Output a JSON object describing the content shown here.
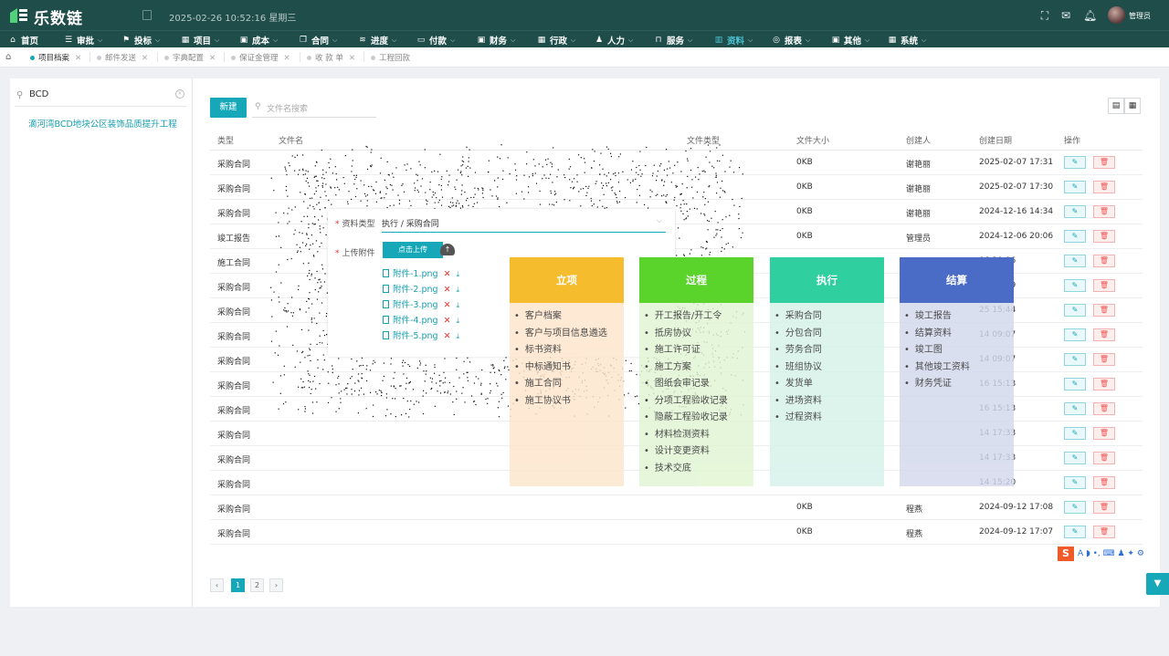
{
  "header": {
    "app_name": "乐数链",
    "datetime": "2025-02-26 10:52:16 星期三",
    "user_name": "管理员",
    "icons": [
      "fullscreen-icon",
      "mail-icon",
      "bell-icon"
    ]
  },
  "nav": [
    {
      "label": "首页",
      "icon": "home-icon",
      "chevron": false
    },
    {
      "label": "审批",
      "icon": "sliders-icon",
      "chevron": true
    },
    {
      "label": "投标",
      "icon": "flag-icon",
      "chevron": true
    },
    {
      "label": "项目",
      "icon": "grid-icon",
      "chevron": true
    },
    {
      "label": "成本",
      "icon": "calendar-icon",
      "chevron": true
    },
    {
      "label": "合同",
      "icon": "copy-icon",
      "chevron": true
    },
    {
      "label": "进度",
      "icon": "stack-icon",
      "chevron": true
    },
    {
      "label": "付款",
      "icon": "card-icon",
      "chevron": true
    },
    {
      "label": "财务",
      "icon": "money-icon",
      "chevron": true
    },
    {
      "label": "行政",
      "icon": "tiles-icon",
      "chevron": true
    },
    {
      "label": "人力",
      "icon": "person-icon",
      "chevron": true
    },
    {
      "label": "服务",
      "icon": "bag-icon",
      "chevron": true
    },
    {
      "label": "资料",
      "icon": "book-icon",
      "chevron": true,
      "active": true
    },
    {
      "label": "报表",
      "icon": "compass-icon",
      "chevron": true
    },
    {
      "label": "其他",
      "icon": "box-icon",
      "chevron": true
    },
    {
      "label": "系统",
      "icon": "apps-icon",
      "chevron": true
    }
  ],
  "tabs": [
    {
      "label": "项目档案",
      "active": true
    },
    {
      "label": "邮件发送",
      "active": false
    },
    {
      "label": "字典配置",
      "active": false
    },
    {
      "label": "保证金管理",
      "active": false
    },
    {
      "label": "收 款 单",
      "active": false
    },
    {
      "label": "工程回款",
      "active": false
    }
  ],
  "left": {
    "search_value": "BCD",
    "tree_item": "滴河湾BCD地块公区装饰品质提升工程"
  },
  "toolbar": {
    "new_label": "新建",
    "search_placeholder": "文件名搜索"
  },
  "table": {
    "headers": [
      "类型",
      "文件名",
      "文件类型",
      "文件大小",
      "创建人",
      "创建日期",
      "操作"
    ],
    "rows": [
      {
        "type": "采购合同",
        "size": "0KB",
        "creator": "谢艳丽",
        "date": "2025-02-07 17:31"
      },
      {
        "type": "采购合同",
        "size": "0KB",
        "creator": "谢艳丽",
        "date": "2025-02-07 17:30"
      },
      {
        "type": "采购合同",
        "size": "0KB",
        "creator": "谢艳丽",
        "date": "2024-12-16 14:34"
      },
      {
        "type": "竣工报告",
        "size": "0KB",
        "creator": "管理员",
        "date": "2024-12-06 20:06"
      },
      {
        "type": "施工合同",
        "size": "",
        "creator": "",
        "date": "06 20:06"
      },
      {
        "type": "采购合同",
        "size": "",
        "creator": "",
        "date": "28 14:49"
      },
      {
        "type": "采购合同",
        "size": "",
        "creator": "",
        "date": "25 15:44"
      },
      {
        "type": "采购合同",
        "size": "",
        "creator": "",
        "date": "14 09:07"
      },
      {
        "type": "采购合同",
        "size": "",
        "creator": "",
        "date": "14 09:07"
      },
      {
        "type": "采购合同",
        "size": "",
        "creator": "",
        "date": "16 15:13"
      },
      {
        "type": "采购合同",
        "size": "",
        "creator": "",
        "date": "16 15:13"
      },
      {
        "type": "采购合同",
        "size": "",
        "creator": "",
        "date": "14 17:33"
      },
      {
        "type": "采购合同",
        "size": "",
        "creator": "",
        "date": "14 17:33"
      },
      {
        "type": "采购合同",
        "size": "",
        "creator": "",
        "date": "14 15:20"
      },
      {
        "type": "采购合同",
        "size": "0KB",
        "creator": "程燕",
        "date": "2024-09-12 17:08"
      },
      {
        "type": "采购合同",
        "size": "0KB",
        "creator": "程燕",
        "date": "2024-09-12 17:07"
      }
    ]
  },
  "pagination": {
    "prev": "‹",
    "pages": [
      "1",
      "2"
    ],
    "next": "›",
    "current": "1"
  },
  "dialog": {
    "category_label": "资料类型",
    "category_value": "执行 / 采购合同",
    "attachment_label": "上传附件",
    "upload_button": "点击上传",
    "attachments": [
      "附件-1.png",
      "附件-2.png",
      "附件-3.png",
      "附件-4.png",
      "附件-5.png"
    ]
  },
  "stages": [
    {
      "title": "立项",
      "head_color": "#f5bd2e",
      "body_color": "#fde5cb",
      "items": [
        "客户档案",
        "客户与项目信息遴选",
        "标书资料",
        "中标通知书",
        "施工合同",
        "施工协议书"
      ]
    },
    {
      "title": "过程",
      "head_color": "#5ad32a",
      "body_color": "#e0f5d2",
      "items": [
        "开工报告/开工令",
        "抵房协议",
        "施工许可证",
        "施工方案",
        "图纸会审记录",
        "分项工程验收记录",
        "隐蔽工程验收记录",
        "材料检测资料",
        "设计变更资料",
        "技术交底"
      ]
    },
    {
      "title": "执行",
      "head_color": "#2fcf9f",
      "body_color": "#d6f2ea",
      "items": [
        "采购合同",
        "分包合同",
        "劳务合同",
        "班组协议",
        "发货单",
        "进场资料",
        "过程资料"
      ]
    },
    {
      "title": "结算",
      "head_color": "#4a6cc7",
      "body_color": "#d3d8ed",
      "items": [
        "竣工报告",
        "结算资料",
        "竣工图",
        "其他竣工资料",
        "财务凭证"
      ]
    }
  ],
  "ime": {
    "brand": "S",
    "tools": "A ◗ •, ⌨ ♟ ✦ ⚙"
  }
}
